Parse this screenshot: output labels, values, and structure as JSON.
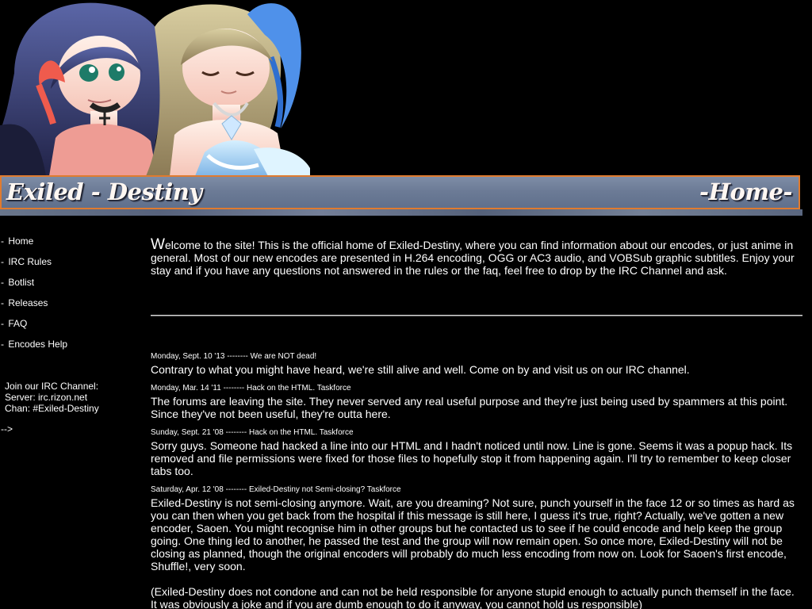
{
  "header": {
    "site_title": "Exiled - Destiny",
    "page_label": "-Home-"
  },
  "sidebar": {
    "items": [
      {
        "prefix": "- ",
        "label": "Home"
      },
      {
        "prefix": "- ",
        "label": "IRC Rules"
      },
      {
        "prefix": "- ",
        "label": "Botlist"
      },
      {
        "prefix": "- ",
        "label": "Releases"
      },
      {
        "prefix": "- ",
        "label": "FAQ"
      },
      {
        "prefix": "- ",
        "label": "Encodes Help"
      }
    ],
    "irc": {
      "title": "Join our IRC Channel:",
      "server": "Server: irc.rizon.net",
      "channel": "Chan: #Exiled-Destiny"
    },
    "stray_text": "-->"
  },
  "content": {
    "welcome_first_letter": "W",
    "welcome_rest": "elcome to the site! This is the official home of Exiled-Destiny, where you can find information about our encodes, or just anime in general. Most of our new encodes are presented in H.264 encoding, OGG or AC3 audio, and VOBSub graphic subtitles. Enjoy your stay and if you have any questions not answered in the rules or the faq, feel free to drop by the IRC Channel and ask.",
    "news": [
      {
        "meta": "Monday, Sept. 10 '13 -------- We are NOT dead!",
        "body": "Contrary to what you might have heard, we're still alive and well. Come on by and visit us on our IRC channel."
      },
      {
        "meta": "Monday, Mar. 14 '11 -------- Hack on the HTML. Taskforce",
        "body": "The forums are leaving the site. They never served any real useful purpose and they're just being used by spammers at this point. Since they've not been useful, they're outta here."
      },
      {
        "meta": "Sunday, Sept. 21 '08 -------- Hack on the HTML. Taskforce",
        "body": "Sorry guys. Someone had hacked a line into our HTML and I hadn't noticed until now. Line is gone. Seems it was a popup hack. Its removed and file permissions were fixed for those files to hopefully stop it from happening again. I'll try to remember to keep closer tabs too."
      },
      {
        "meta": "Saturday, Apr. 12 '08 -------- Exiled-Destiny not Semi-closing? Taskforce",
        "body": "Exiled-Destiny is not semi-closing anymore. Wait, are you dreaming? Not sure, punch yourself in the face 12 or so times as hard as you can then when you get back from the hospital if this message is still here, I guess it's true, right? Actually, we've gotten a new encoder, Saoen. You might recognise him in other groups but he contacted us to see if he could encode and help keep the group going. One thing led to another, he passed the test and the group will now remain open. So once more, Exiled-Destiny will not be closing as planned, though the original encoders will probably do much less encoding from now on. Look for Saoen's first encode, Shuffle!, very soon."
      }
    ],
    "extra_note": "(Exiled-Destiny does not condone and can not be held responsible for anyone stupid enough to actually punch themself in the face. It was obviously a joke and if you are dumb enough to do it anyway, you cannot hold us responsible)"
  }
}
